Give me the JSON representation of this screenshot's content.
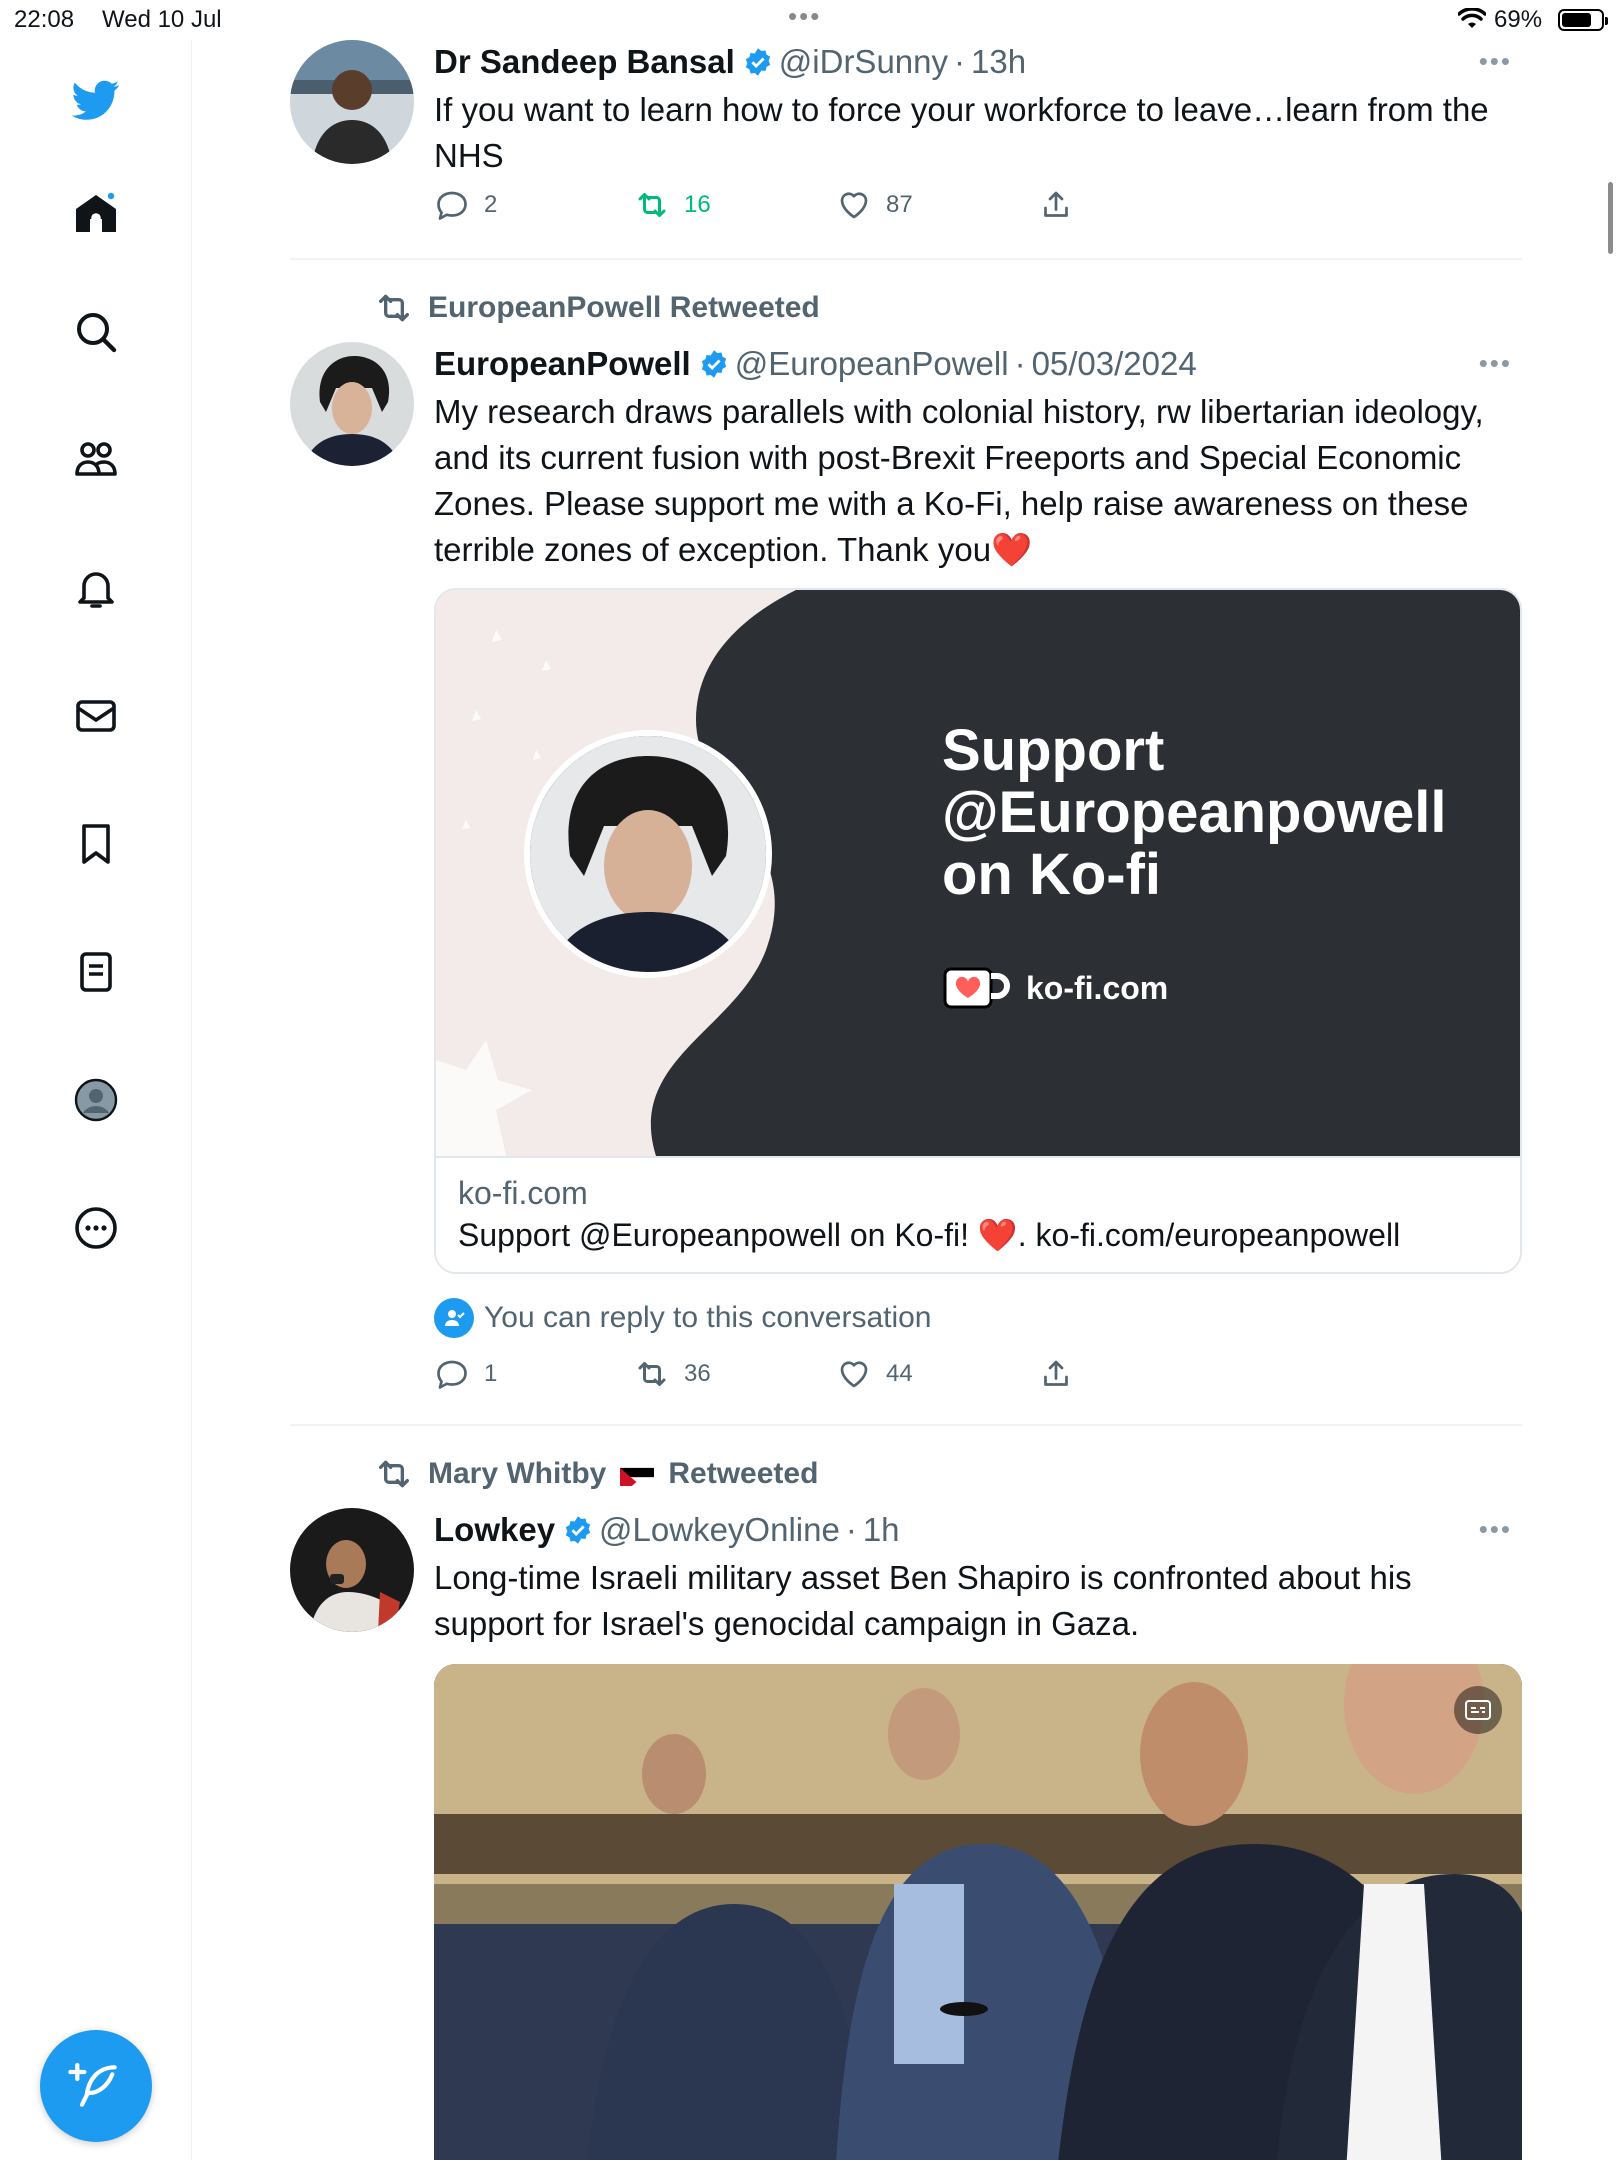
{
  "status_bar": {
    "time": "22:08",
    "date": "Wed 10 Jul",
    "battery": "69%"
  },
  "sidebar": {
    "items": [
      {
        "icon": "twitter-bird-icon",
        "label": "Twitter"
      },
      {
        "icon": "home-icon",
        "label": "Home"
      },
      {
        "icon": "search-icon",
        "label": "Explore"
      },
      {
        "icon": "communities-icon",
        "label": "Communities"
      },
      {
        "icon": "bell-icon",
        "label": "Notifications"
      },
      {
        "icon": "mail-icon",
        "label": "Messages"
      },
      {
        "icon": "bookmark-icon",
        "label": "Bookmarks"
      },
      {
        "icon": "lists-icon",
        "label": "Lists"
      },
      {
        "icon": "profile-icon",
        "label": "Profile"
      },
      {
        "icon": "more-circle-icon",
        "label": "More"
      }
    ],
    "compose_icon": "compose-icon"
  },
  "tweets": [
    {
      "name": "Dr Sandeep Bansal",
      "handle": "@iDrSunny",
      "time": "13h",
      "text": "If you want to learn how to force your workforce to leave…learn from the NHS",
      "replies": "2",
      "retweets": "16",
      "likes": "87",
      "retweeted_by_me": true
    },
    {
      "retweeted_by": "EuropeanPowell Retweeted",
      "name": "EuropeanPowell",
      "handle": "@EuropeanPowell",
      "time": "05/03/2024",
      "text": "My research draws parallels with colonial history, rw libertarian ideology, and its current fusion with post-Brexit Freeports and Special Economic Zones. Please support me with a Ko-Fi, help raise awareness on these terrible zones of exception. Thank you❤️",
      "card": {
        "title": "Support @Europeanpowell on Ko-fi",
        "logo_text": "ko-fi.com",
        "domain": "ko-fi.com",
        "description": "Support @Europeanpowell on Ko-fi! ❤️. ko-fi.com/europeanpowell"
      },
      "reply_note": "You can reply to this conversation",
      "replies": "1",
      "retweets": "36",
      "likes": "44"
    },
    {
      "retweeted_by_name": "Mary Whitby",
      "retweeted_by_suffix": "Retweeted",
      "name": "Lowkey",
      "handle": "@LowkeyOnline",
      "time": "1h",
      "text": "Long-time Israeli military asset Ben Shapiro is confronted about his support for Israel's genocidal campaign in Gaza."
    }
  ],
  "colors": {
    "accent": "#1d9bf0",
    "retweet_green": "#00ba7c",
    "muted": "#536471",
    "card_dark": "#2c2f33"
  }
}
